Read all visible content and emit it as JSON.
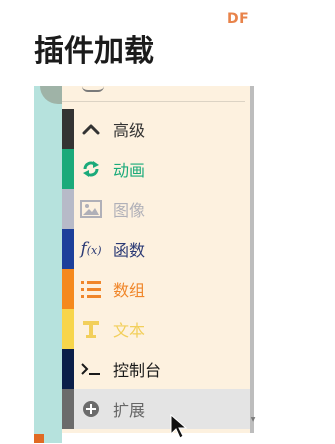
{
  "header": {
    "brand": "DF",
    "brand_color": "#e8834a",
    "title": "插件加载"
  },
  "toolbox": {
    "categories": [
      {
        "id": "advanced",
        "label": "高级",
        "icon": "chevron-up-icon",
        "color": "#333333",
        "label_color": "#333333"
      },
      {
        "id": "animation",
        "label": "动画",
        "icon": "refresh-icon",
        "color": "#1aaa7a",
        "label_color": "#1aaa7a"
      },
      {
        "id": "image",
        "label": "图像",
        "icon": "image-icon",
        "color": "#b7bac8",
        "label_color": "#b0b0b8"
      },
      {
        "id": "functions",
        "label": "函数",
        "icon": "function-icon",
        "color": "#1c3f9a",
        "label_color": "#2b3a75"
      },
      {
        "id": "arrays",
        "label": "数组",
        "icon": "list-icon",
        "color": "#f5891c",
        "label_color": "#f0862a"
      },
      {
        "id": "text",
        "label": "文本",
        "icon": "text-icon",
        "color": "#f7d54b",
        "label_color": "#f2cf5b"
      },
      {
        "id": "console",
        "label": "控制台",
        "icon": "terminal-icon",
        "color": "#0b1f49",
        "label_color": "#1a1a1a"
      },
      {
        "id": "extensions",
        "label": "扩展",
        "icon": "add-circle-icon",
        "color": "#6b6b6b",
        "label_color": "#666666",
        "selected": true
      }
    ]
  }
}
